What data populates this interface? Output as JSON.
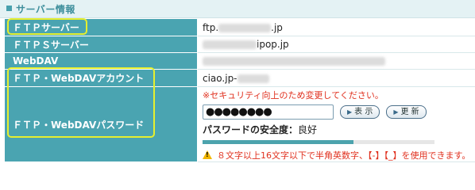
{
  "section": {
    "title": "サーバー情報"
  },
  "rows": {
    "ftp_server": {
      "label": "ＦＴＰサーバー",
      "value_prefix": "ftp.",
      "value_suffix": ".jp"
    },
    "ftps_server": {
      "label": "ＦＴＰＳサーバー",
      "value_suffix": "ipop.jp"
    },
    "webdav": {
      "label": "WebDAV"
    },
    "account": {
      "label": "ＦＴＰ・WebDAVアカウント",
      "value_prefix": "ciao.jp-"
    },
    "password": {
      "label": "ＦＴＰ・WebDAVパスワード",
      "notice": "※セキュリティ向上のため変更してください。",
      "value": "●●●●●●●●",
      "show_button": "表 示",
      "change_button": "更 新",
      "strength_label": "パスワードの安全度：",
      "strength_value": "良好",
      "strength_fraction": 0.65,
      "rule_note": "８文字以上16文字以下で半角英数字、【-】【_】を使用できます。"
    }
  },
  "colors": {
    "label_bg": "#4aa4b1",
    "highlight": "#e6ef2e",
    "warning": "#e0301e"
  }
}
